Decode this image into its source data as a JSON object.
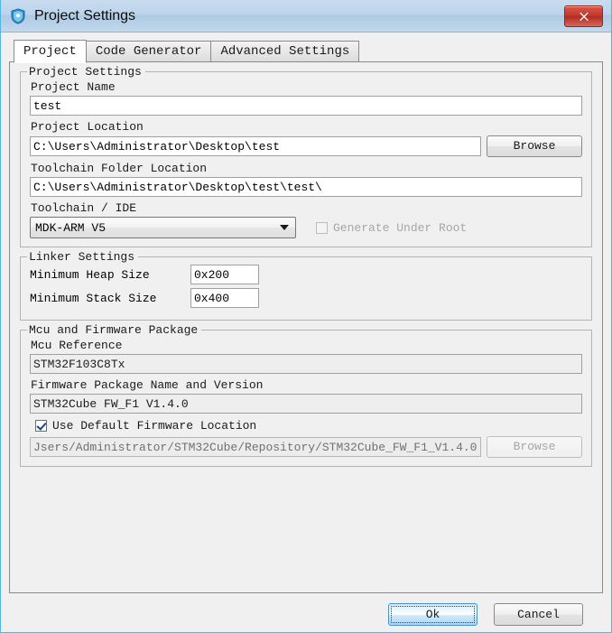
{
  "window": {
    "title": "Project Settings",
    "icon": "shield-icon",
    "close_label": "x",
    "accent_titlebar": "#bcd4ea",
    "close_color": "#c3392c"
  },
  "tabs": [
    {
      "label": "Project",
      "active": true
    },
    {
      "label": "Code Generator",
      "active": false
    },
    {
      "label": "Advanced Settings",
      "active": false
    }
  ],
  "project_settings": {
    "group_title": "Project Settings",
    "project_name_label": "Project Name",
    "project_name_value": "test",
    "project_location_label": "Project Location",
    "project_location_value": "C:\\Users\\Administrator\\Desktop\\test",
    "browse_label": "Browse",
    "toolchain_folder_label": "Toolchain Folder Location",
    "toolchain_folder_value": "C:\\Users\\Administrator\\Desktop\\test\\test\\",
    "toolchain_ide_label": "Toolchain / IDE",
    "toolchain_ide_value": "MDK-ARM V5",
    "generate_under_root_label": "Generate Under Root",
    "generate_under_root_checked": false,
    "generate_under_root_enabled": false
  },
  "linker_settings": {
    "group_title": "Linker Settings",
    "heap_label": "Minimum Heap Size",
    "heap_value": "0x200",
    "stack_label": "Minimum Stack Size",
    "stack_value": "0x400"
  },
  "mcu_firmware": {
    "group_title": "Mcu and Firmware Package",
    "mcu_reference_label": "Mcu Reference",
    "mcu_reference_value": "STM32F103C8Tx",
    "firmware_package_label": "Firmware Package Name and Version",
    "firmware_package_value": "STM32Cube FW_F1 V1.4.0",
    "use_default_label": "Use Default Firmware Location",
    "use_default_checked": true,
    "firmware_path_value": "Jsers/Administrator/STM32Cube/Repository/STM32Cube_FW_F1_V1.4.0",
    "firmware_browse_label": "Browse",
    "firmware_browse_enabled": false
  },
  "footer": {
    "ok_label": "Ok",
    "cancel_label": "Cancel"
  }
}
